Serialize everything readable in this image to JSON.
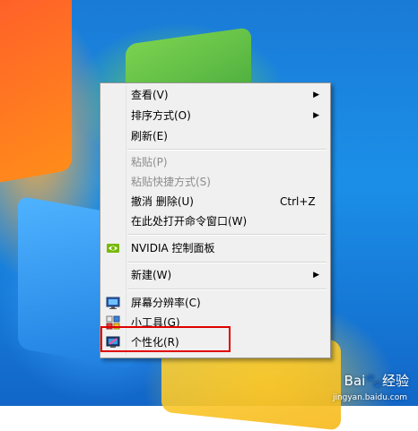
{
  "menu": {
    "items": [
      {
        "label": "查看(V)",
        "shortcut": "",
        "submenu": true,
        "disabled": false,
        "icon": ""
      },
      {
        "label": "排序方式(O)",
        "shortcut": "",
        "submenu": true,
        "disabled": false,
        "icon": ""
      },
      {
        "label": "刷新(E)",
        "shortcut": "",
        "submenu": false,
        "disabled": false,
        "icon": ""
      },
      {
        "label": "粘贴(P)",
        "shortcut": "",
        "submenu": false,
        "disabled": true,
        "icon": ""
      },
      {
        "label": "粘贴快捷方式(S)",
        "shortcut": "",
        "submenu": false,
        "disabled": true,
        "icon": ""
      },
      {
        "label": "撤消 删除(U)",
        "shortcut": "Ctrl+Z",
        "submenu": false,
        "disabled": false,
        "icon": ""
      },
      {
        "label": "在此处打开命令窗口(W)",
        "shortcut": "",
        "submenu": false,
        "disabled": false,
        "icon": ""
      },
      {
        "label": "NVIDIA 控制面板",
        "shortcut": "",
        "submenu": false,
        "disabled": false,
        "icon": "nvidia-icon"
      },
      {
        "label": "新建(W)",
        "shortcut": "",
        "submenu": true,
        "disabled": false,
        "icon": ""
      },
      {
        "label": "屏幕分辨率(C)",
        "shortcut": "",
        "submenu": false,
        "disabled": false,
        "icon": "monitor-icon"
      },
      {
        "label": "小工具(G)",
        "shortcut": "",
        "submenu": false,
        "disabled": false,
        "icon": "gadgets-icon"
      },
      {
        "label": "个性化(R)",
        "shortcut": "",
        "submenu": false,
        "disabled": false,
        "icon": "personalize-icon"
      }
    ],
    "submenu_arrow": "▶"
  },
  "watermark": {
    "logo": "Bai🐾经验",
    "url": "jingyan.baidu.com"
  }
}
